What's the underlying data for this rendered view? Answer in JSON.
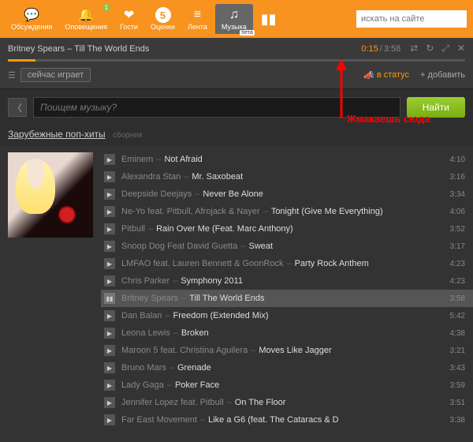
{
  "topnav": {
    "items": [
      {
        "label": "Обсуждения",
        "icon": "💬"
      },
      {
        "label": "Оповещения",
        "icon": "🔔",
        "badge": "1"
      },
      {
        "label": "Гости",
        "icon": "❤"
      },
      {
        "label": "Оценки",
        "icon": "5"
      },
      {
        "label": "Лента",
        "icon": "≡"
      },
      {
        "label": "Музыка",
        "icon": "♫",
        "beta": "бета"
      }
    ],
    "search_placeholder": "искать на сайте"
  },
  "player": {
    "now_playing": "Britney Spears – Till The World Ends",
    "current": "0:15",
    "total": "3:58",
    "now_label": "сейчас играет",
    "status_label": "в статус",
    "add_label": "+ добавить"
  },
  "search": {
    "placeholder": "Поищем музыку?",
    "button": "Найти"
  },
  "category": {
    "title": "Зарубежные поп-хиты",
    "sub": "сборник"
  },
  "tracks": [
    {
      "artist": "Eminem",
      "song": "Not Afraid",
      "dur": "4:10"
    },
    {
      "artist": "Alexandra Stan",
      "song": "Mr. Saxobeat",
      "dur": "3:16"
    },
    {
      "artist": "Deepside Deejays",
      "song": "Never Be Alone",
      "dur": "3:34"
    },
    {
      "artist": "Ne-Yo feat. Pitbull, Afrojack & Nayer",
      "song": "Tonight (Give Me Everything)",
      "dur": "4:06"
    },
    {
      "artist": "Pitbull",
      "song": "Rain Over Me (Feat. Marc Anthony)",
      "dur": "3:52"
    },
    {
      "artist": "Snoop Dog Feat David Guetta",
      "song": "Sweat",
      "dur": "3:17"
    },
    {
      "artist": "LMFAO feat. Lauren Bennett & GoonRock",
      "song": "Party Rock Anthem",
      "dur": "4:23"
    },
    {
      "artist": "Chris Parker",
      "song": "Symphony 2011",
      "dur": "4:23"
    },
    {
      "artist": "Britney Spears",
      "song": "Till The World Ends",
      "dur": "3:58",
      "playing": true
    },
    {
      "artist": "Dan Balan",
      "song": "Freedom (Extended Mix)",
      "dur": "5:42"
    },
    {
      "artist": "Leona Lewis",
      "song": "Broken",
      "dur": "4:38"
    },
    {
      "artist": "Maroon 5 feat. Christina Aguilera",
      "song": "Moves Like Jagger",
      "dur": "3:21"
    },
    {
      "artist": "Bruno Mars",
      "song": "Grenade",
      "dur": "3:43"
    },
    {
      "artist": "Lady Gaga",
      "song": "Poker Face",
      "dur": "3:59"
    },
    {
      "artist": "Jennifer Lopez feat. Pitbull",
      "song": "On The Floor",
      "dur": "3:51"
    },
    {
      "artist": "Far East Movement",
      "song": "Like a G6 (feat. The Cataracs & D",
      "dur": "3:38"
    }
  ],
  "annotation": "Жмакаешь сюда"
}
